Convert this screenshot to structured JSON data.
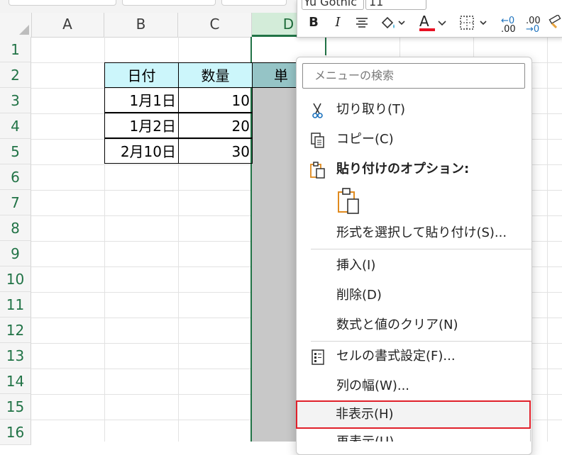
{
  "column_headers": [
    "A",
    "B",
    "C",
    "D"
  ],
  "row_headers": [
    "1",
    "2",
    "3",
    "4",
    "5",
    "6",
    "7",
    "8",
    "9",
    "10",
    "11",
    "12",
    "13",
    "14",
    "15",
    "16"
  ],
  "table": {
    "headers": [
      "日付",
      "数量",
      "単価"
    ],
    "rows": [
      {
        "date": "1月1日",
        "qty": "10"
      },
      {
        "date": "1月2日",
        "qty": "20"
      },
      {
        "date": "2月10日",
        "qty": "30"
      }
    ]
  },
  "mini_toolbar": {
    "font_name": "Yu Gothic",
    "font_size": "11",
    "bold": "B",
    "italic": "I",
    "font_color_letter": "A",
    "font_color": "#e81123",
    "dec_decrease": ".00",
    "dec_increase": ".00"
  },
  "context_menu": {
    "search_placeholder": "メニューの検索",
    "items": [
      {
        "label": "切り取り(T)",
        "icon": "scissors-icon"
      },
      {
        "label": "コピー(C)",
        "icon": "copy-icon"
      },
      {
        "label": "貼り付けのオプション:",
        "icon": "clipboard-icon"
      },
      {
        "label": "形式を選択して貼り付け(S)...",
        "icon": ""
      },
      {
        "label": "挿入(I)",
        "icon": ""
      },
      {
        "label": "削除(D)",
        "icon": ""
      },
      {
        "label": "数式と値のクリア(N)",
        "icon": ""
      },
      {
        "label": "セルの書式設定(F)...",
        "icon": "format-cells-icon"
      },
      {
        "label": "列の幅(W)...",
        "icon": ""
      },
      {
        "label": "非表示(H)",
        "icon": ""
      },
      {
        "label": "再表示(U)",
        "icon": ""
      }
    ]
  },
  "colors": {
    "accent_green": "#217346",
    "header_cyan": "#ccf6fb",
    "highlight_red": "#e0202a"
  }
}
